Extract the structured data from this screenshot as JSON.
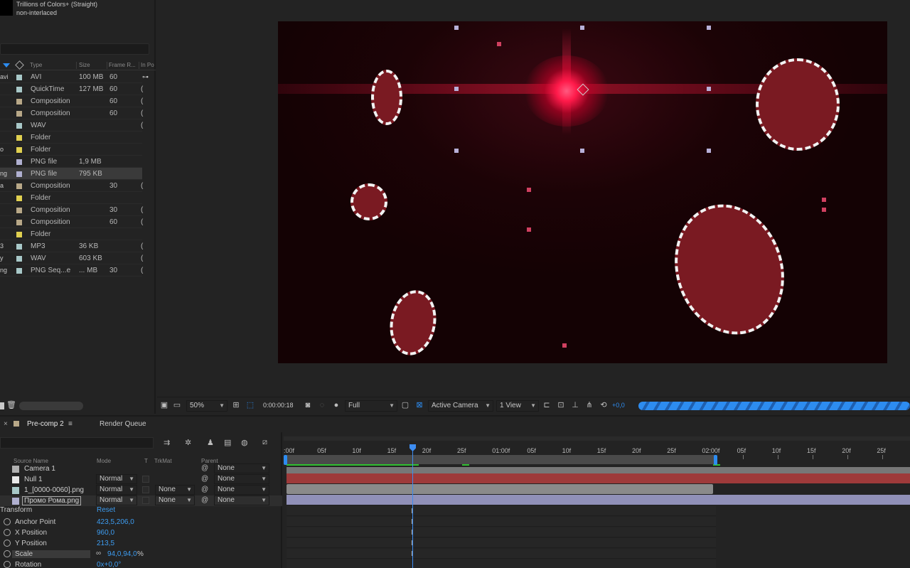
{
  "project": {
    "footage_info": [
      "Trillions of Colors+ (Straight)",
      "non-interlaced"
    ],
    "headers": {
      "type": "Type",
      "size": "Size",
      "frame_rate": "Frame R...",
      "in_point": "In Po"
    },
    "items": [
      {
        "name": "avi",
        "type": "AVI",
        "size": "100 MB",
        "frame_rate": "60",
        "in": "",
        "color": "#a8c8c8"
      },
      {
        "name": "",
        "type": "QuickTime",
        "size": "127 MB",
        "frame_rate": "60",
        "in": "(",
        "color": "#a8c8c8"
      },
      {
        "name": "",
        "type": "Composition",
        "size": "",
        "frame_rate": "60",
        "in": "(",
        "color": "#b8a888"
      },
      {
        "name": "",
        "type": "Composition",
        "size": "",
        "frame_rate": "60",
        "in": "(",
        "color": "#b8a888"
      },
      {
        "name": "",
        "type": "WAV",
        "size": "",
        "frame_rate": "",
        "in": "(",
        "color": "#a8c8c8"
      },
      {
        "name": "",
        "type": "Folder",
        "size": "",
        "frame_rate": "",
        "in": "",
        "color": "#e0d050"
      },
      {
        "name": "o",
        "type": "Folder",
        "size": "",
        "frame_rate": "",
        "in": "",
        "color": "#e0d050"
      },
      {
        "name": "",
        "type": "PNG file",
        "size": "1,9 MB",
        "frame_rate": "",
        "in": "",
        "color": "#b0b0d0"
      },
      {
        "name": "ng",
        "type": "PNG file",
        "size": "795 KB",
        "frame_rate": "",
        "in": "",
        "color": "#b0b0d0"
      },
      {
        "name": "a",
        "type": "Composition",
        "size": "",
        "frame_rate": "30",
        "in": "(",
        "color": "#b8a888"
      },
      {
        "name": "",
        "type": "Folder",
        "size": "",
        "frame_rate": "",
        "in": "",
        "color": "#e0d050"
      },
      {
        "name": "",
        "type": "Composition",
        "size": "",
        "frame_rate": "30",
        "in": "(",
        "color": "#b8a888"
      },
      {
        "name": "",
        "type": "Composition",
        "size": "",
        "frame_rate": "60",
        "in": "(",
        "color": "#b8a888"
      },
      {
        "name": "",
        "type": "Folder",
        "size": "",
        "frame_rate": "",
        "in": "",
        "color": "#e0d050"
      },
      {
        "name": "3",
        "type": "MP3",
        "size": "36 KB",
        "frame_rate": "",
        "in": "(",
        "color": "#a8c8c8"
      },
      {
        "name": "y",
        "type": "WAV",
        "size": "603 KB",
        "frame_rate": "",
        "in": "(",
        "color": "#a8c8c8"
      },
      {
        "name": "ng",
        "type": "PNG Seq...e",
        "size": "... MB",
        "frame_rate": "30",
        "in": "(",
        "color": "#a8c8c8"
      }
    ],
    "trash_icon": "trash-icon"
  },
  "viewer": {
    "zoom": "50%",
    "timecode": "0:00:00:18",
    "resolution": "Full",
    "camera": "Active Camera",
    "views": "1 View",
    "exposure": "+0,0",
    "accent": "#2d8cf0"
  },
  "timeline": {
    "tabs": [
      "Pre-comp 2",
      "Render Queue"
    ],
    "headers": {
      "source_name": "Source Name",
      "mode": "Mode",
      "t": "T",
      "trkmat": "TrkMat",
      "parent": "Parent"
    },
    "ruler": [
      ":00f",
      "05f",
      "10f",
      "15f",
      "20f",
      "25f",
      "01:00f",
      "05f",
      "10f",
      "15f",
      "20f",
      "25f",
      "02:00f",
      "05f",
      "10f",
      "15f",
      "20f",
      "25f"
    ],
    "layers": [
      {
        "name": "Camera 1",
        "mode": "",
        "trkmat": "",
        "parent": "None",
        "color": "#b0b0b0"
      },
      {
        "name": "Null 1",
        "mode": "Normal",
        "trkmat": "",
        "parent": "None",
        "color": "#e8e8e8"
      },
      {
        "name": "1_[0000-0060].png",
        "mode": "Normal",
        "trkmat": "None",
        "parent": "None",
        "color": "#a8c8c8"
      },
      {
        "name": "Промо Рома.png",
        "mode": "Normal",
        "trkmat": "None",
        "parent": "None",
        "color": "#b0b0d0"
      }
    ],
    "transform": {
      "label": "Transform",
      "reset": "Reset",
      "props": [
        {
          "name": "Anchor Point",
          "value": "423,5,206,0"
        },
        {
          "name": "X Position",
          "value": "960,0"
        },
        {
          "name": "Y Position",
          "value": "213,5"
        },
        {
          "name": "Scale",
          "value": "94,0,94,0",
          "unit": "%"
        },
        {
          "name": "Rotation",
          "value": "0x+0,0°"
        }
      ]
    },
    "playhead_color": "#3d8cf0",
    "track_colors": {
      "null": "#9e3a3a",
      "precomp": "#8a8a8a",
      "png": "#9090b8"
    }
  }
}
